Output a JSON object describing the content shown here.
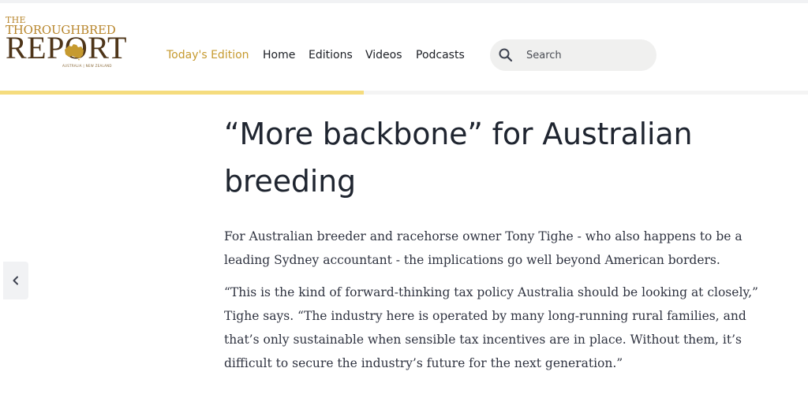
{
  "logo": {
    "the": "THE",
    "thoroughbred": "THOROUGHBRED",
    "report": "REPORT",
    "sub": "AUSTRALIA | NEW ZEALAND"
  },
  "nav": {
    "items": [
      {
        "label": "Today's Edition",
        "active": true
      },
      {
        "label": "Home",
        "active": false
      },
      {
        "label": "Editions",
        "active": false
      },
      {
        "label": "Videos",
        "active": false
      },
      {
        "label": "Podcasts",
        "active": false
      }
    ]
  },
  "search": {
    "placeholder": "Search",
    "icon": "search-icon"
  },
  "reading_progress": 0.45,
  "side_tab": {
    "icon": "chevron-left-icon"
  },
  "article": {
    "headline": "“More backbone” for Australian breeding",
    "paragraphs": [
      "For Australian breeder and racehorse owner Tony Tighe - who also happens to be a leading Sydney accountant - the implications go well beyond American borders.",
      "“This is the kind of forward-thinking tax policy Australia should be looking at closely,” Tighe says. “The industry here is operated by many long-running rural families, and that’s only sustainable when sensible tax incentives are in place. Without them, it’s difficult to secure the industry’s future for the next generation.”"
    ]
  },
  "colors": {
    "accent": "#c69a2f",
    "progress": "#f5dc7e",
    "text": "#1f2530"
  }
}
